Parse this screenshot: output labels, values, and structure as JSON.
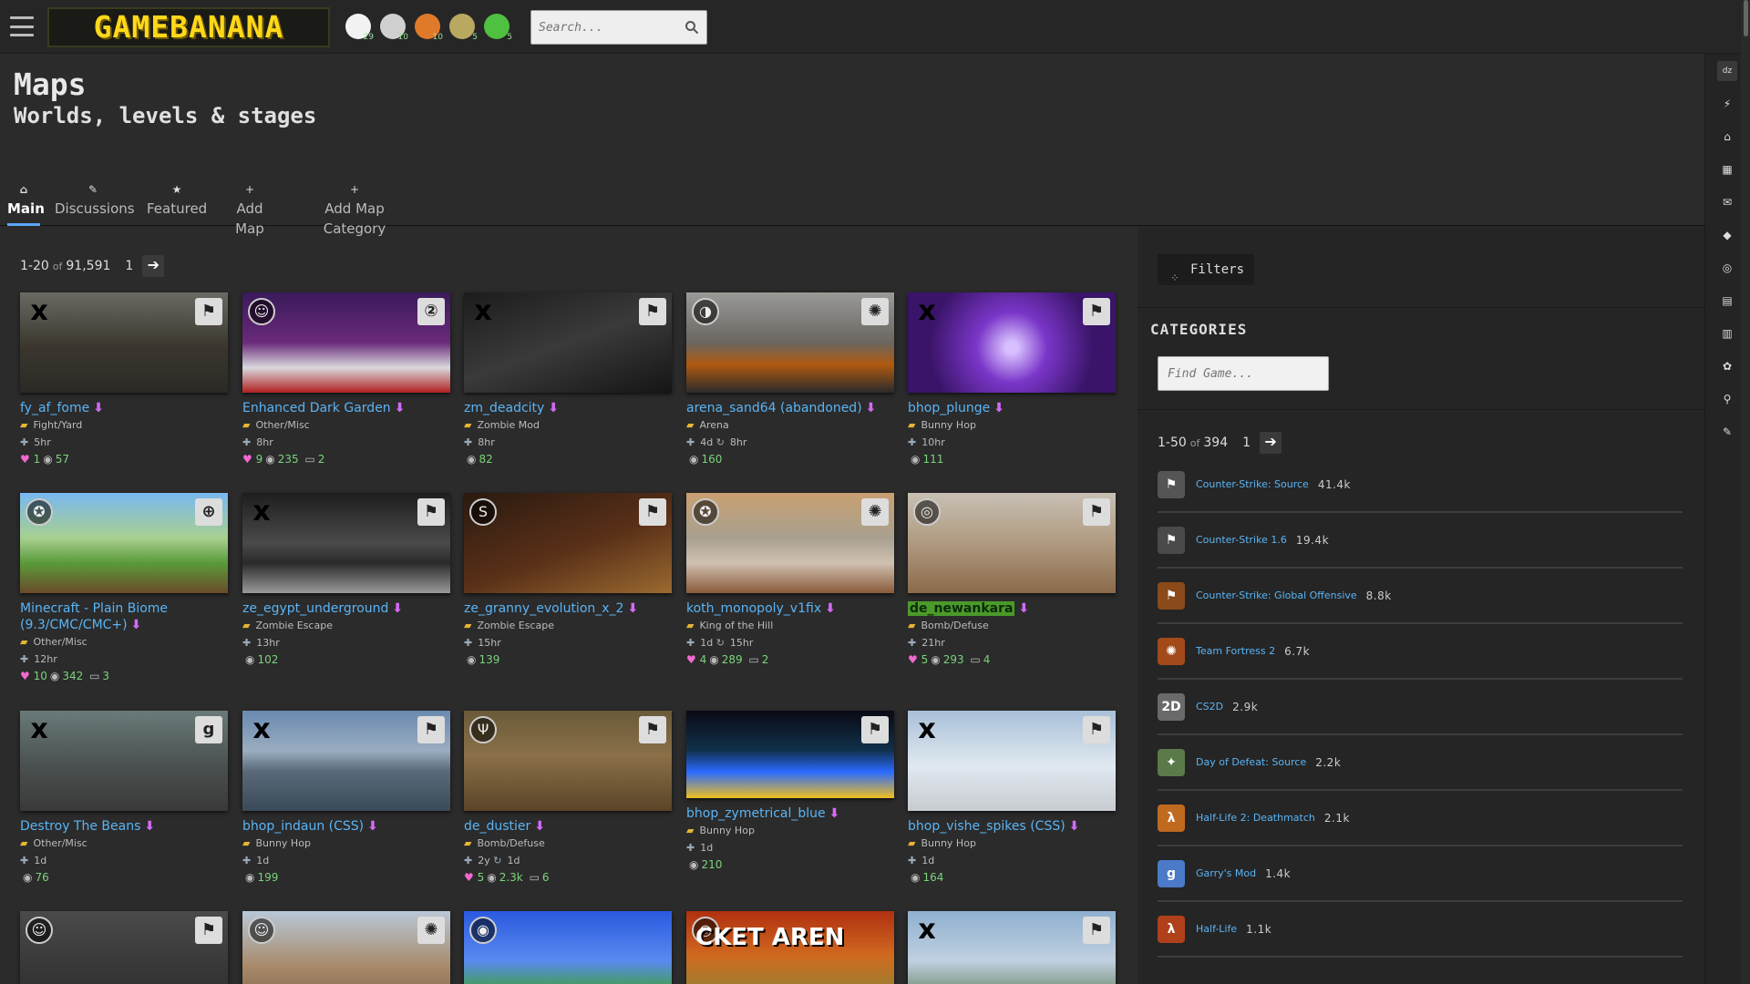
{
  "topbar": {
    "logo_text": "GAMEBANANA",
    "search_placeholder": "Search...",
    "game_icons": [
      {
        "name": "smash-bros-icon",
        "badge": "29",
        "color": "#f2f2f2"
      },
      {
        "name": "star-wars-icon",
        "badge": "10",
        "color": "#d0d0d0"
      },
      {
        "name": "team-fortress-icon",
        "badge": "10",
        "color": "#e07a2a"
      },
      {
        "name": "fnaf-icon",
        "badge": "5",
        "color": "#b8a860"
      },
      {
        "name": "half-life-alyx-icon",
        "badge": "5",
        "color": "#4fc040"
      }
    ]
  },
  "header": {
    "title": "Maps",
    "subtitle": "Worlds, levels & stages"
  },
  "tabs": [
    {
      "label": "Main",
      "icon": "home-icon",
      "glyph": "⌂"
    },
    {
      "label": "Discussions",
      "icon": "discussions-icon",
      "glyph": "✎"
    },
    {
      "label": "Featured",
      "icon": "star-icon",
      "glyph": "★"
    },
    {
      "label": "Add Map",
      "icon": "plus-icon",
      "glyph": "+"
    },
    {
      "label": "Add Map Category",
      "icon": "plus-icon",
      "glyph": "+"
    }
  ],
  "pager": {
    "range": "1-20",
    "of": "of",
    "total": "91,591",
    "page": "1"
  },
  "cards": [
    {
      "name": "fy_af_fome",
      "cat": "Fight/Yard",
      "time": "5hr",
      "likes": "1",
      "views": "57",
      "posts": "",
      "bg": "linear-gradient(180deg,#6a6a62,#3a362e 55%,#2c2a26)",
      "sub": "x",
      "cls": "⚑"
    },
    {
      "name": "Enhanced Dark Garden",
      "cat": "Other/Misc",
      "time": "8hr",
      "likes": "9",
      "views": "235",
      "posts": "2",
      "bg": "linear-gradient(180deg,#3a1a5a,#6a2a7a 50%,#d8d8dc 75%,#b02020)",
      "sub": "☺",
      "cls": "②"
    },
    {
      "name": "zm_deadcity",
      "cat": "Zombie Mod",
      "time": "8hr",
      "likes": "",
      "views": "82",
      "posts": "",
      "bg": "linear-gradient(160deg,#1c1c1c,#3a3a3a 50%,#151515)",
      "sub": "x",
      "cls": "⚑"
    },
    {
      "name": "arena_sand64 (abandoned)",
      "cat": "Arena",
      "time": "4d",
      "time2": "8hr",
      "likes": "",
      "views": "160",
      "posts": "",
      "bg": "linear-gradient(180deg,#9a9a98,#6a6660 50%,#b05a10 72%,#2a2a2a)",
      "sub": "◑",
      "cls": "✺"
    },
    {
      "name": "bhop_plunge",
      "cat": "Bunny Hop",
      "time": "10hr",
      "likes": "",
      "views": "111",
      "posts": "",
      "bg": "radial-gradient(circle at 50% 55%,#d8c0ff 5%,#7a36c8 30%,#3a1468 70%)",
      "sub": "x",
      "cls": "⚑"
    },
    {
      "name": "Minecraft - Plain Biome (9.3/CMC/CMC+)",
      "cat": "Other/Misc",
      "time": "12hr",
      "likes": "10",
      "views": "342",
      "posts": "3",
      "bg": "linear-gradient(180deg,#7ab8f0,#a8d090 45%,#5a9a3a 70%,#6a4a2a)",
      "sub": "✪",
      "cls": "⊕"
    },
    {
      "name": "ze_egypt_underground",
      "cat": "Zombie Escape",
      "time": "13hr",
      "likes": "",
      "views": "102",
      "posts": "",
      "bg": "linear-gradient(180deg,#1e1e1e,#4a4a4a 50%,#2a2a2a 70%,#9a9a9a)",
      "sub": "x",
      "cls": "⚑"
    },
    {
      "name": "ze_granny_evolution_x_2",
      "cat": "Zombie Escape",
      "time": "15hr",
      "likes": "",
      "views": "139",
      "posts": "",
      "bg": "linear-gradient(160deg,#2a1a10,#5a3018 55%,#9a6a30)",
      "sub": "S",
      "cls": "⚑"
    },
    {
      "name": "koth_monopoly_v1fix",
      "cat": "King of the Hill",
      "time": "1d",
      "time2": "15hr",
      "likes": "4",
      "views": "289",
      "posts": "2",
      "bg": "linear-gradient(180deg,#c8a070,#a8a090 45%,#d0c0b0 70%,#8a5a3a)",
      "sub": "✪",
      "cls": "✺"
    },
    {
      "name": "de_newankara",
      "cat": "Bomb/Defuse",
      "time": "21hr",
      "likes": "5",
      "views": "293",
      "posts": "4",
      "bg": "linear-gradient(180deg,#c8c0b4,#b09a80 50%,#8a6a4a)",
      "sub": "◎",
      "cls": "⚑"
    },
    {
      "name": "Destroy The Beans",
      "cat": "Other/Misc",
      "time": "1d",
      "likes": "",
      "views": "76",
      "posts": "",
      "bg": "linear-gradient(180deg,#6a7a7a,#4a5050 55%,#3a3a38)",
      "sub": "x",
      "cls": "g"
    },
    {
      "name": "bhop_indaun (CSS)",
      "cat": "Bunny Hop",
      "time": "1d",
      "likes": "",
      "views": "199",
      "posts": "",
      "bg": "linear-gradient(180deg,#6a8ab0,#9aacc0 40%,#5a6a7a 60%,#3a4a58)",
      "sub": "x",
      "cls": "⚑"
    },
    {
      "name": "de_dustier",
      "cat": "Bomb/Defuse",
      "time": "2y",
      "time2": "1d",
      "likes": "5",
      "views": "2.3k",
      "posts": "6",
      "bg": "linear-gradient(180deg,#6a5a3a,#8a7048 45%,#5a4428)",
      "sub": "Ψ",
      "cls": "⚑"
    },
    {
      "name": "bhop_zymetrical_blue",
      "cat": "Bunny Hop",
      "time": "1d",
      "likes": "",
      "views": "210",
      "posts": "",
      "bg": "linear-gradient(180deg,#0a0a14,#10304a 45%,#2a6aff 70%,#f0c020)",
      "sub": "",
      "cls": "⚑"
    },
    {
      "name": "bhop_vishe_spikes (CSS)",
      "cat": "Bunny Hop",
      "time": "1d",
      "likes": "",
      "views": "164",
      "posts": "",
      "bg": "linear-gradient(180deg,#a8c0d8,#e0e8f0 55%,#c8ccd0)",
      "sub": "x",
      "cls": "⚑"
    },
    {
      "name": "",
      "cat": "",
      "time": "",
      "likes": "",
      "views": "",
      "posts": "",
      "bg": "linear-gradient(180deg,#4a4a4a,#2a2a2a)",
      "sub": "☺",
      "cls": "⚑"
    },
    {
      "name": "",
      "cat": "",
      "time": "",
      "likes": "",
      "views": "",
      "posts": "",
      "bg": "linear-gradient(180deg,#b8c8d8,#a88a6a 55%,#7a6048)",
      "sub": "☺",
      "cls": "✺"
    },
    {
      "name": "",
      "cat": "",
      "time": "",
      "likes": "",
      "views": "",
      "posts": "",
      "bg": "linear-gradient(180deg,#2a5adf,#5a8aef 50%,#40a040 80%)",
      "sub": "◉",
      "cls": ""
    },
    {
      "name": "",
      "cat": "",
      "time": "",
      "likes": "",
      "views": "",
      "posts": "",
      "bg": "linear-gradient(180deg,#b03010,#d06a20 45%,#7a8a3a)",
      "sub": "◎",
      "cls": "",
      "overlay": "CKET AREN"
    },
    {
      "name": "",
      "cat": "",
      "time": "",
      "likes": "",
      "views": "",
      "posts": "",
      "bg": "linear-gradient(180deg,#90b0d0,#c0d0e0 50%,#4a6a3a)",
      "sub": "x",
      "cls": "⚑"
    }
  ],
  "sidebar": {
    "filters_label": "Filters",
    "categories_title": "CATEGORIES",
    "find_game_placeholder": "Find Game...",
    "pager": {
      "range": "1-50",
      "of": "of",
      "total": "394",
      "page": "1"
    },
    "games": [
      {
        "name": "Counter-Strike: Source",
        "count": "41.4k",
        "icon": "css-icon",
        "color": "#555",
        "glyph": "⚑"
      },
      {
        "name": "Counter-Strike 1.6",
        "count": "19.4k",
        "icon": "cs16-icon",
        "color": "#4a4a4a",
        "glyph": "⚑"
      },
      {
        "name": "Counter-Strike: Global Offensive",
        "count": "8.8k",
        "icon": "csgo-icon",
        "color": "#8a4a1a",
        "glyph": "⚑"
      },
      {
        "name": "Team Fortress 2",
        "count": "6.7k",
        "icon": "tf2-icon",
        "color": "#a24a1a",
        "glyph": "✺"
      },
      {
        "name": "CS2D",
        "count": "2.9k",
        "icon": "cs2d-icon",
        "color": "#6a6a6a",
        "glyph": "2D"
      },
      {
        "name": "Day of Defeat: Source",
        "count": "2.2k",
        "icon": "dods-icon",
        "color": "#5a7a4a",
        "glyph": "✦"
      },
      {
        "name": "Half-Life 2: Deathmatch",
        "count": "2.1k",
        "icon": "hl2dm-icon",
        "color": "#c06a20",
        "glyph": "λ"
      },
      {
        "name": "Garry's Mod",
        "count": "1.4k",
        "icon": "gmod-icon",
        "color": "#4a7ac8",
        "glyph": "g"
      },
      {
        "name": "Half-Life",
        "count": "1.1k",
        "icon": "half-life-icon",
        "color": "#b0401a",
        "glyph": "λ"
      }
    ]
  },
  "rail": [
    {
      "icon": "dz-icon",
      "glyph": "dz"
    },
    {
      "icon": "bolt-icon",
      "glyph": "⚡"
    },
    {
      "icon": "bank-icon",
      "glyph": "⌂"
    },
    {
      "icon": "grid-icon",
      "glyph": "▦"
    },
    {
      "icon": "mail-icon",
      "glyph": "✉"
    },
    {
      "icon": "diamond-icon",
      "glyph": "◆"
    },
    {
      "icon": "coins-icon",
      "glyph": "◎"
    },
    {
      "icon": "archive-icon",
      "glyph": "▤"
    },
    {
      "icon": "chart-icon",
      "glyph": "▥"
    },
    {
      "icon": "palette-icon",
      "glyph": "✿"
    },
    {
      "icon": "pin-icon",
      "glyph": "⚲"
    },
    {
      "icon": "edit-icon",
      "glyph": "✎"
    }
  ]
}
